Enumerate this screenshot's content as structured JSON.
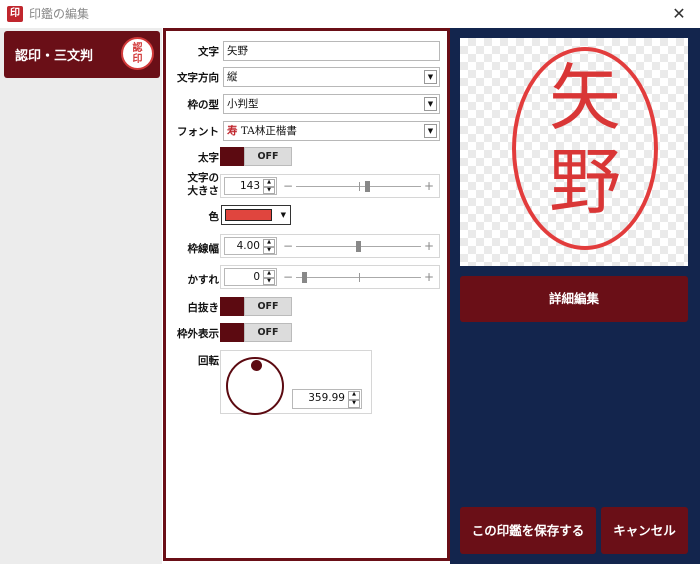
{
  "window": {
    "app_icon": "印",
    "title": "印鑑の編集",
    "close": "✕"
  },
  "left_panel": {
    "selected_type": "認印・三文判",
    "thumb_chars": [
      "認",
      "印"
    ]
  },
  "form": {
    "text": {
      "label": "文字",
      "value": "矢野"
    },
    "direction": {
      "label": "文字方向",
      "value": "縦"
    },
    "frame": {
      "label": "枠の型",
      "value": "小判型"
    },
    "font": {
      "label": "フォント",
      "sample_glyph": "寿",
      "value": "TA林正楷書"
    },
    "bold": {
      "label": "太字",
      "state": "OFF"
    },
    "size": {
      "label_line1": "文字の",
      "label_line2": "大きさ",
      "value": "143",
      "slider_fraction": 0.5
    },
    "color": {
      "label": "色",
      "value": "#e0453e"
    },
    "frame_width": {
      "label": "枠線幅",
      "value": "4.00",
      "slider_fraction": 0.43
    },
    "blur": {
      "label": "かすれ",
      "value": "0",
      "slider_fraction": 0.0
    },
    "white_out": {
      "label": "白抜き",
      "state": "OFF"
    },
    "outside_frame": {
      "label": "枠外表示",
      "state": "OFF"
    },
    "rotation": {
      "label": "回転",
      "value": "359.99"
    }
  },
  "preview": {
    "chars": [
      "矢",
      "野"
    ],
    "seal_color": "#e23c3c"
  },
  "buttons": {
    "detail_edit": "詳細編集",
    "save": "この印鑑を保存する",
    "cancel": "キャンセル"
  },
  "colors": {
    "accent_dark": "#6a0f17",
    "panel_navy": "#13254d"
  }
}
